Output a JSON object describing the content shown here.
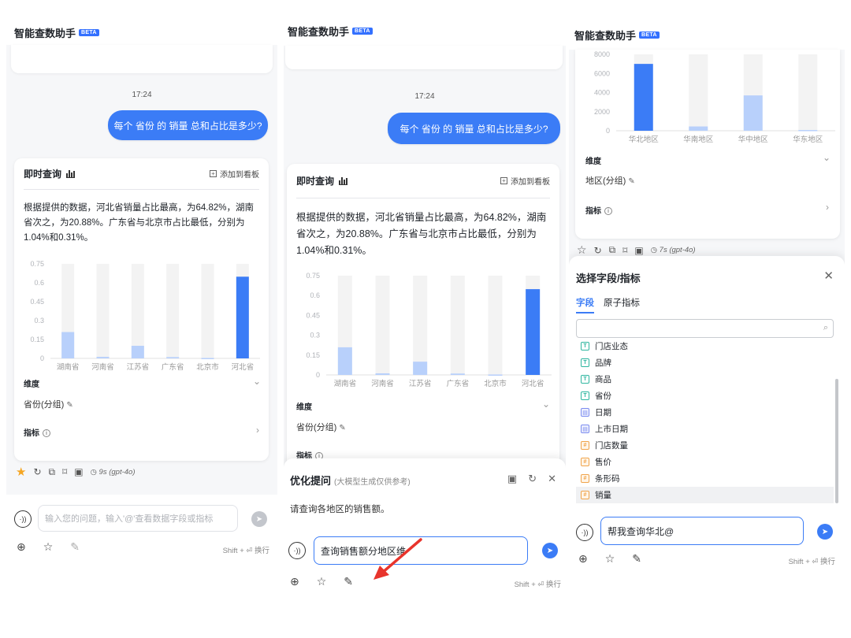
{
  "app": {
    "title": "智能查数助手",
    "badge": "BETA"
  },
  "chat": {
    "time": "17:24",
    "question": "每个 省份 的 销量 总和占比是多少?"
  },
  "result_card": {
    "title": "即时查询",
    "add_to_board": "添加到看板",
    "answer": "根据提供的数据，河北省销量占比最高，为64.82%，湖南省次之，为20.88%。广东省与北京市占比最低，分别为1.04%和0.31%。",
    "dimension_label": "维度",
    "dimension_value": "省份(分组)",
    "metric_label": "指标"
  },
  "actions": {
    "panel1_model": "9s (gpt-4o)",
    "panel3_model": "7s (gpt-4o)"
  },
  "input": {
    "placeholder": "输入您的问题，输入'@'查看数据字段或指标",
    "shift_hint": "Shift + ⏎ 换行",
    "panel2_value": "查询销售额分地区维",
    "panel3_value": "帮我查询华北@"
  },
  "optimize_sheet": {
    "title": "优化提问",
    "subtitle": "(大模型生成仅供参考)",
    "suggestion": "请查询各地区的销售额。"
  },
  "region_card": {
    "dimension_label": "维度",
    "dimension_value": "地区(分组)",
    "metric_label": "指标"
  },
  "field_sheet": {
    "title": "选择字段/指标",
    "tabs": [
      "字段",
      "原子指标"
    ],
    "fields": [
      {
        "type": "T",
        "name": "门店业态"
      },
      {
        "type": "T",
        "name": "品牌"
      },
      {
        "type": "T",
        "name": "商品"
      },
      {
        "type": "T",
        "name": "省份"
      },
      {
        "type": "D",
        "name": "日期"
      },
      {
        "type": "D",
        "name": "上市日期"
      },
      {
        "type": "#",
        "name": "门店数量"
      },
      {
        "type": "#",
        "name": "售价"
      },
      {
        "type": "#",
        "name": "条形码"
      },
      {
        "type": "#",
        "name": "销量"
      }
    ]
  },
  "colors": {
    "accent": "#3b7cf6",
    "bar_highlight": "#3b7cf6",
    "bar_light": "#b8d0fb",
    "bar_track": "#f3f3f3"
  },
  "chart_data": [
    {
      "type": "bar",
      "categories": [
        "湖南省",
        "河南省",
        "江苏省",
        "广东省",
        "北京市",
        "河北省"
      ],
      "values": [
        0.2088,
        0.012,
        0.1,
        0.0104,
        0.0031,
        0.6482
      ],
      "yticks": [
        "0.75",
        "0.6",
        "0.45",
        "0.3",
        "0.15",
        "0"
      ],
      "ylim": [
        0,
        0.75
      ],
      "highlight_index": 5
    },
    {
      "type": "bar",
      "categories": [
        "华北地区",
        "华南地区",
        "华中地区",
        "华东地区"
      ],
      "values": [
        7000,
        450,
        3700,
        80
      ],
      "yticks": [
        "8000",
        "6000",
        "4000",
        "2000",
        "0"
      ],
      "ylim": [
        0,
        8000
      ],
      "highlight_index": 0
    }
  ]
}
